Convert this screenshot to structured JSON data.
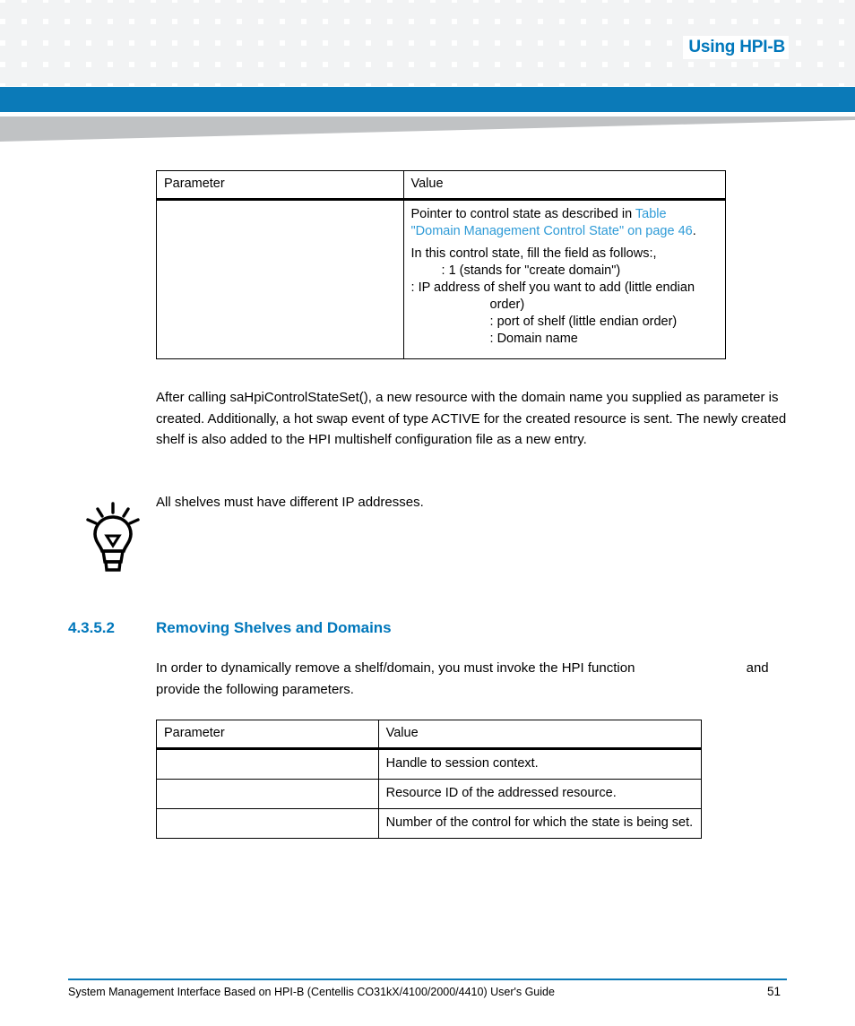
{
  "header": {
    "title": "Using HPI-B",
    "accent_blue": "#0b7ab8",
    "title_blue": "#0077bb",
    "swoosh_gray": "#c0c2c4",
    "pattern_gray": "#f2f3f4"
  },
  "table1": {
    "columns": [
      "Parameter",
      "Value"
    ],
    "rows": [
      {
        "parameter": "",
        "value_lines": [
          {
            "text_before": "Pointer to control state as described in ",
            "link": "Table \"Domain Management Control State\" on page 46",
            "text_after": ".",
            "indent": 0
          },
          {
            "text_before": "In this control state, fill the field            as follows:,",
            "link": "",
            "text_after": "",
            "indent": 0
          },
          {
            "text_before": ": 1 (stands for \"create domain\")",
            "link": "",
            "text_after": "",
            "indent": 1
          },
          {
            "text_before": ": IP address of shelf you want to add (little endian order)",
            "link": "",
            "text_after": "",
            "indent": 2
          },
          {
            "text_before": ": port of shelf (little endian order)",
            "link": "",
            "text_after": "",
            "indent": 2
          },
          {
            "text_before": ": Domain name",
            "link": "",
            "text_after": "",
            "indent": 2
          }
        ]
      }
    ]
  },
  "paragraph1": "After calling saHpiControlStateSet(), a new resource with the domain name you supplied as parameter is created. Additionally, a hot swap event of type ACTIVE for the created resource is sent. The newly created shelf is also added to the HPI multishelf configuration file as a new entry.",
  "tip": {
    "icon": "lightbulb-icon",
    "text": "All shelves must have different IP addresses."
  },
  "section": {
    "number": "4.3.5.2",
    "title": "Removing Shelves and Domains",
    "color": "#0077bb"
  },
  "paragraph2_line1": "In order to dynamically remove a shelf/domain, you must invoke the HPI function",
  "paragraph2_line2": "and provide the following parameters.",
  "table2": {
    "columns": [
      "Parameter",
      "Value"
    ],
    "rows": [
      {
        "parameter": "",
        "value": "Handle to session context."
      },
      {
        "parameter": "",
        "value": "Resource ID of the addressed resource."
      },
      {
        "parameter": "",
        "value": "Number of the control for which the state is being set."
      }
    ]
  },
  "footer": {
    "text": "System Management Interface Based on HPI-B (Centellis CO31kX/4100/2000/4410) User's Guide",
    "page": "51"
  }
}
